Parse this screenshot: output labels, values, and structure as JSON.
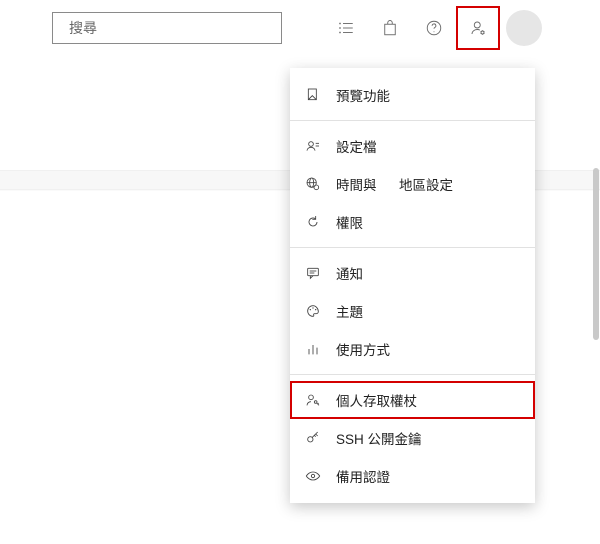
{
  "search": {
    "placeholder": "搜尋"
  },
  "menu": {
    "sections": [
      [
        {
          "key": "preview",
          "label": "預覽功能"
        }
      ],
      [
        {
          "key": "profile",
          "label": "設定檔"
        },
        {
          "key": "time-region",
          "label": "時間與      地區設定"
        },
        {
          "key": "permissions",
          "label": "權限"
        }
      ],
      [
        {
          "key": "notifications",
          "label": "通知"
        },
        {
          "key": "theme",
          "label": "主題"
        },
        {
          "key": "usage",
          "label": "使用方式"
        }
      ],
      [
        {
          "key": "pat",
          "label": "個人存取權杖",
          "highlight": true
        },
        {
          "key": "ssh",
          "label": "SSH 公開金鑰"
        },
        {
          "key": "alt-creds",
          "label": "備用認證"
        }
      ]
    ]
  }
}
